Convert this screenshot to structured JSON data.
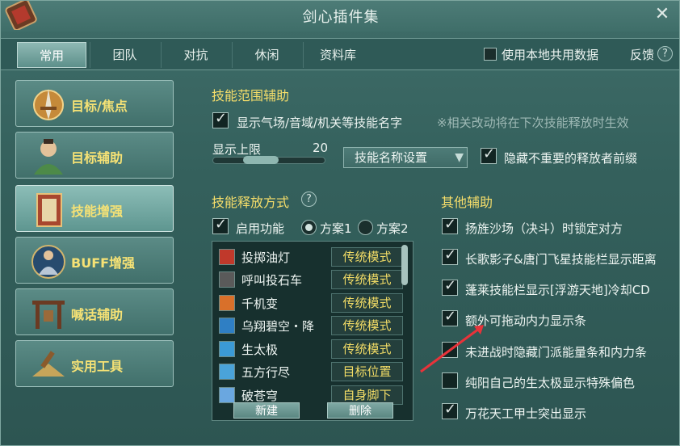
{
  "window": {
    "title": "剑心插件集"
  },
  "tabs": [
    "常用",
    "团队",
    "对抗",
    "休闲",
    "资料库"
  ],
  "header": {
    "share_label": "使用本地共用数据",
    "feedback_label": "反馈",
    "help": "?"
  },
  "sidebar": [
    {
      "label": "目标/焦点",
      "icon": "sword-emblem-icon"
    },
    {
      "label": "目标辅助",
      "icon": "character-portrait-icon"
    },
    {
      "label": "技能增强",
      "icon": "skill-book-icon"
    },
    {
      "label": "BUFF增强",
      "icon": "buff-figure-icon"
    },
    {
      "label": "喊话辅助",
      "icon": "gate-icon"
    },
    {
      "label": "实用工具",
      "icon": "tools-icon"
    }
  ],
  "skill_range": {
    "title": "技能范围辅助",
    "show_names_label": "显示气场/音域/机关等技能名字",
    "note": "※相关改动将在下次技能释放时生效",
    "limit_label": "显示上限",
    "limit_value": "20",
    "limit_fraction": 0.35,
    "name_setting": "技能名称设置",
    "hide_prefix_label": "隐藏不重要的释放者前缀"
  },
  "release_mode": {
    "title": "技能释放方式",
    "enable_label": "启用功能",
    "plan1": "方案1",
    "plan2": "方案2",
    "rows": [
      {
        "name": "投掷油灯",
        "mode": "传统模式"
      },
      {
        "name": "呼叫投石车",
        "mode": "传统模式"
      },
      {
        "name": "千机变",
        "mode": "传统模式"
      },
      {
        "name": "乌翔碧空・降",
        "mode": "传统模式"
      },
      {
        "name": "生太极",
        "mode": "传统模式"
      },
      {
        "name": "五方行尽",
        "mode": "目标位置"
      },
      {
        "name": "破苍穹",
        "mode": "自身脚下"
      }
    ],
    "new_button": "新建",
    "delete_button": "删除"
  },
  "other": {
    "title": "其他辅助",
    "items": [
      {
        "label": "扬旌沙场（决斗）时锁定对方",
        "checked": true
      },
      {
        "label": "长歌影子&唐门飞星技能栏显示距离",
        "checked": true
      },
      {
        "label": "蓬莱技能栏显示[浮游天地]冷却CD",
        "checked": true
      },
      {
        "label": "额外可拖动内力显示条",
        "checked": true
      },
      {
        "label": "未进战时隐藏门派能量条和内力条",
        "checked": false
      },
      {
        "label": "纯阳自己的生太极显示特殊偏色",
        "checked": false
      },
      {
        "label": "万花天工甲士突出显示",
        "checked": true
      }
    ]
  },
  "colors": {
    "accent_yellow": "#f6de6a",
    "annotation_red": "#e8333a"
  }
}
